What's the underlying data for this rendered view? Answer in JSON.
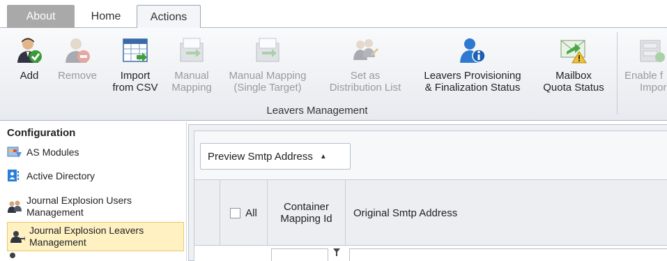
{
  "tabs": [
    {
      "label": "About"
    },
    {
      "label": "Home"
    },
    {
      "label": "Actions"
    }
  ],
  "ribbon": {
    "buttons": [
      {
        "line1": "Add",
        "line2": "",
        "icon": "user-add-icon",
        "enabled": true
      },
      {
        "line1": "Remove",
        "line2": "",
        "icon": "user-remove-icon",
        "enabled": false
      },
      {
        "line1": "Import",
        "line2": "from CSV",
        "icon": "import-csv-icon",
        "enabled": true
      },
      {
        "line1": "Manual",
        "line2": "Mapping",
        "icon": "manual-mapping-icon",
        "enabled": false
      },
      {
        "line1": "Manual Mapping",
        "line2": "(Single Target)",
        "icon": "manual-mapping-single-icon",
        "enabled": false
      },
      {
        "line1": "Set as",
        "line2": "Distribution List",
        "icon": "distribution-list-icon",
        "enabled": false
      },
      {
        "line1": "Leavers Provisioning",
        "line2": "& Finalization Status",
        "icon": "info-user-icon",
        "enabled": true
      },
      {
        "line1": "Mailbox",
        "line2": "Quota Status",
        "icon": "mailbox-warning-icon",
        "enabled": true
      },
      {
        "line1": "Enable f",
        "line2": "Impor",
        "icon": "enable-import-icon",
        "enabled": false
      }
    ],
    "group_label": "Leavers Management"
  },
  "sidebar": {
    "title": "Configuration",
    "items": [
      {
        "label": "AS Modules",
        "icon": "modules-icon"
      },
      {
        "label": "Active Directory",
        "icon": "directory-icon"
      },
      {
        "label": "Journal Explosion Users Management",
        "line1": "Journal Explosion Users",
        "line2": "Management",
        "icon": "users-group-icon"
      },
      {
        "line1": "Journal Explosion Leavers",
        "line2": "Management",
        "icon": "leavers-icon",
        "selected": true
      }
    ]
  },
  "main": {
    "preview_button": "Preview Smtp Address",
    "columns": {
      "all": "All",
      "container_line1": "Container",
      "container_line2": "Mapping Id",
      "original": "Original Smtp Address"
    }
  },
  "colors": {
    "selected_bg": "#fff1c2",
    "about_tab_bg": "#a9a9a9",
    "ribbon_bg": "#eef0f3"
  }
}
